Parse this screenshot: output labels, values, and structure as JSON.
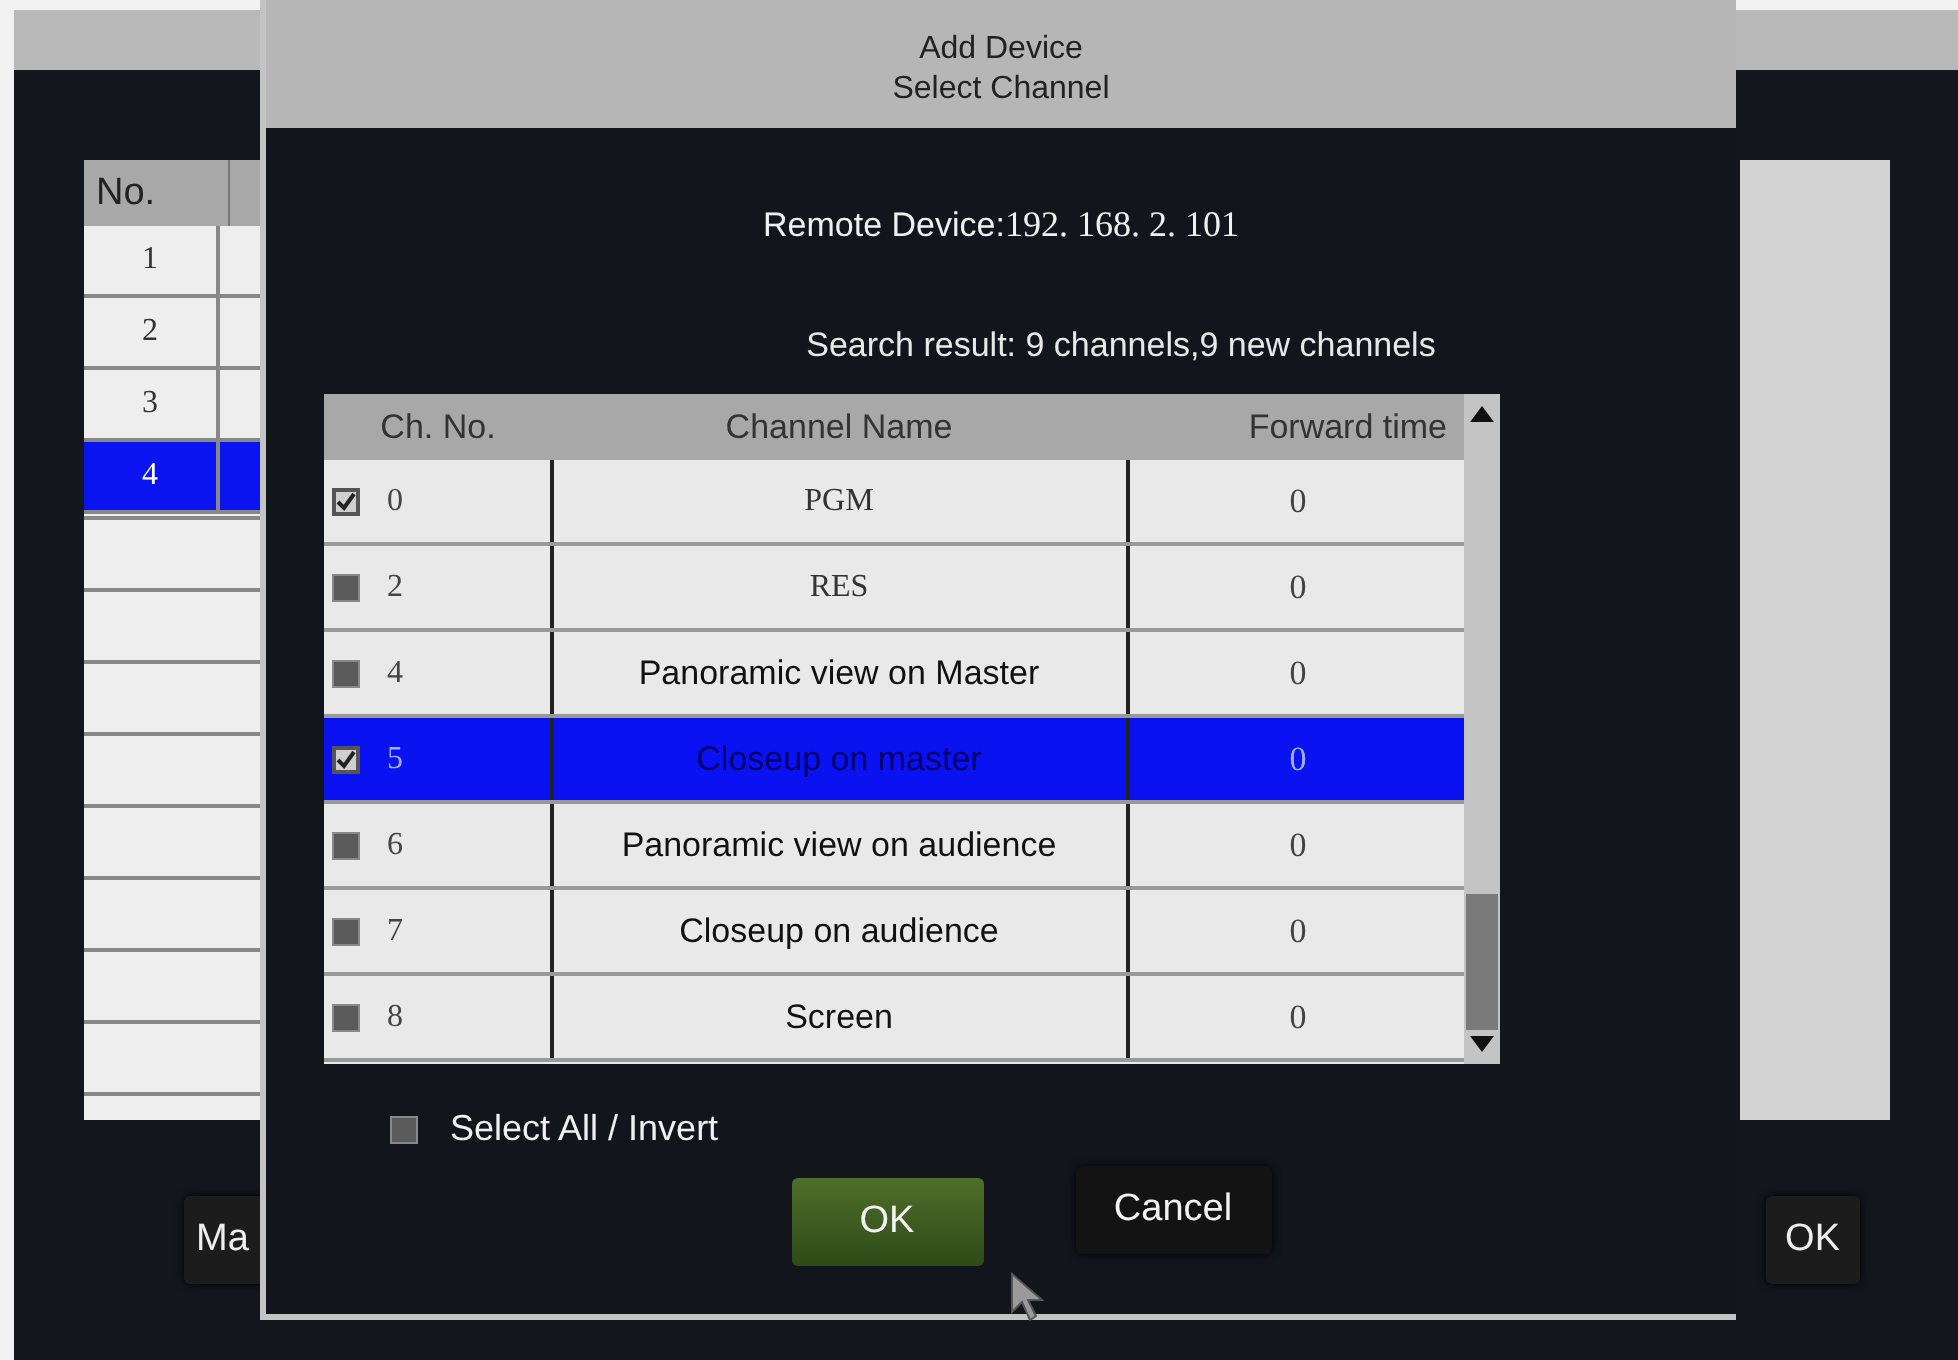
{
  "background_window": {
    "table": {
      "columns": [
        "No."
      ],
      "rows": [
        {
          "no": "1",
          "selected": false
        },
        {
          "no": "2",
          "selected": false
        },
        {
          "no": "3",
          "selected": false
        },
        {
          "no": "4",
          "selected": true
        }
      ]
    },
    "buttons": [
      "Ma",
      "OK"
    ]
  },
  "dialog": {
    "title": "Add Device",
    "subtitle": "Select Channel",
    "remote_device_label": "Remote Device:",
    "remote_device": "192. 168. 2. 101",
    "search_result": "Search result: 9 channels,9 new channels",
    "table": {
      "columns": [
        "Ch. No.",
        "Channel Name",
        "Forward time"
      ],
      "rows": [
        {
          "checked": true,
          "no": "0",
          "name": "PGM",
          "forward": "0",
          "selected": false
        },
        {
          "checked": false,
          "no": "2",
          "name": "RES",
          "forward": "0",
          "selected": false
        },
        {
          "checked": false,
          "no": "4",
          "name": "Panoramic view on Master",
          "forward": "0",
          "selected": false
        },
        {
          "checked": true,
          "no": "5",
          "name": "Closeup on master",
          "forward": "0",
          "selected": true
        },
        {
          "checked": false,
          "no": "6",
          "name": "Panoramic view on audience",
          "forward": "0",
          "selected": false
        },
        {
          "checked": false,
          "no": "7",
          "name": "Closeup on audience",
          "forward": "0",
          "selected": false
        },
        {
          "checked": false,
          "no": "8",
          "name": "Screen",
          "forward": "0",
          "selected": false
        }
      ]
    },
    "select_all": {
      "label": "Select All / Invert",
      "checked": false
    },
    "buttons": [
      {
        "label": "OK",
        "kind": "primary"
      },
      {
        "label": "Cancel",
        "kind": "normal"
      }
    ]
  }
}
